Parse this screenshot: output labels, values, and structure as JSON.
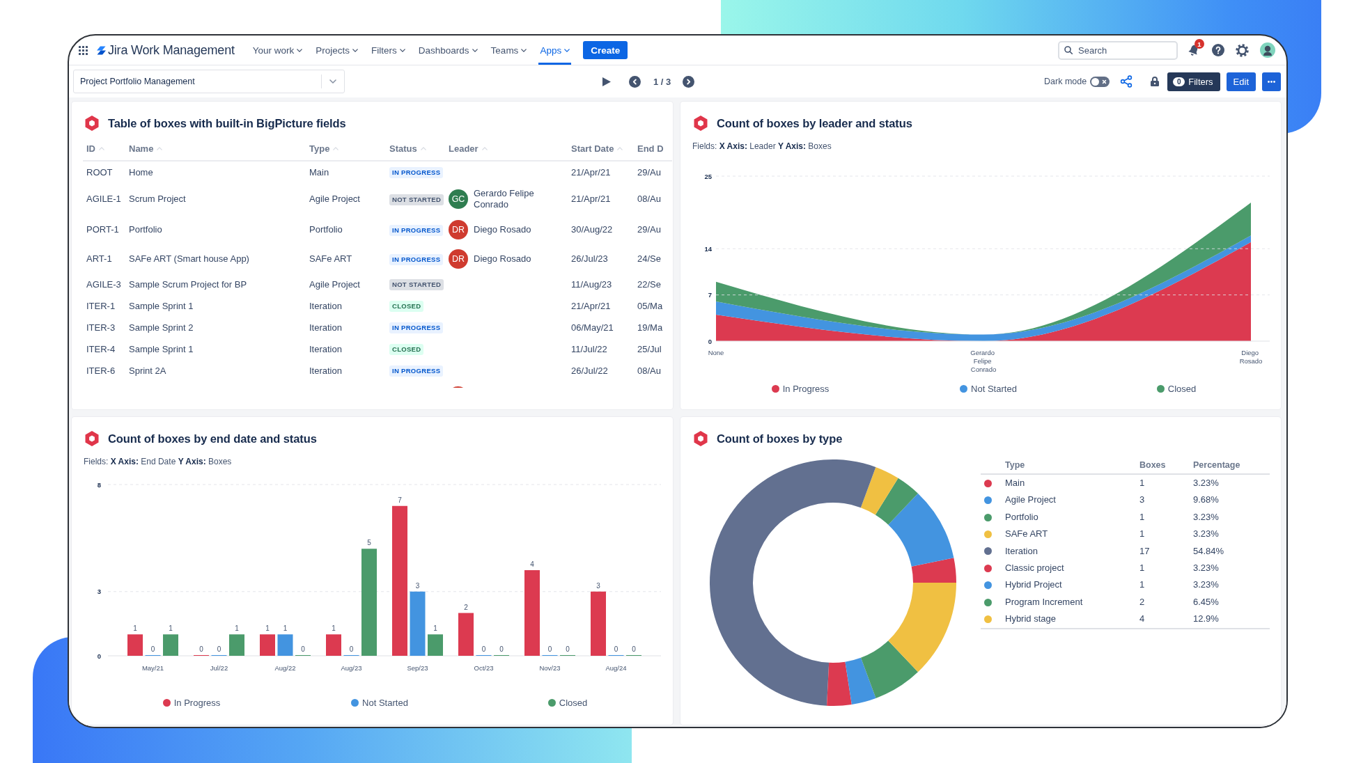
{
  "header": {
    "app_name": "Jira Work Management",
    "nav_items": [
      {
        "label": "Your work",
        "selected": false
      },
      {
        "label": "Projects",
        "selected": false
      },
      {
        "label": "Filters",
        "selected": false
      },
      {
        "label": "Dashboards",
        "selected": false
      },
      {
        "label": "Teams",
        "selected": false
      },
      {
        "label": "Apps",
        "selected": true
      }
    ],
    "create_button": "Create",
    "search": {
      "placeholder": "Search"
    },
    "notification_count": "1"
  },
  "toolbar": {
    "board_select": {
      "value": "Project Portfolio Management"
    },
    "pager": "1 / 3",
    "dark_mode": {
      "label": "Dark mode",
      "on": false
    },
    "filters_button": {
      "count": "0",
      "label": "Filters"
    },
    "edit_button": "Edit"
  },
  "panels": [
    {
      "kind": "table",
      "title": "Table of boxes with built-in BigPicture fields",
      "columns": [
        "ID",
        "Name",
        "Type",
        "Status",
        "Leader",
        "Start Date",
        "End D"
      ],
      "rows": [
        {
          "id": "ROOT",
          "name": "Home",
          "type": "Main",
          "status": {
            "label": "IN PROGRESS",
            "kind": "in_progress"
          },
          "start_date": "21/Apr/21",
          "column_7": "29/Au"
        },
        {
          "id": "AGILE-1",
          "name": "Scrum Project",
          "type": "Agile Project",
          "status": {
            "label": "NOT STARTED",
            "kind": "not_started"
          },
          "leader": {
            "initials": "GC",
            "name": "Gerardo Felipe Conrado",
            "color": "#2f7d50"
          },
          "start_date": "21/Apr/21",
          "column_7": "08/Au"
        },
        {
          "id": "PORT-1",
          "name": "Portfolio",
          "type": "Portfolio",
          "status": {
            "label": "IN PROGRESS",
            "kind": "in_progress"
          },
          "leader": {
            "initials": "DR",
            "name": "Diego Rosado",
            "color": "#cf3b2f"
          },
          "start_date": "30/Aug/22",
          "column_7": "29/Au"
        },
        {
          "id": "ART-1",
          "name": "SAFe ART (Smart house App)",
          "type": "SAFe ART",
          "status": {
            "label": "IN PROGRESS",
            "kind": "in_progress"
          },
          "leader": {
            "initials": "DR",
            "name": "Diego Rosado",
            "color": "#cf3b2f"
          },
          "start_date": "26/Jul/23",
          "column_7": "24/Se"
        },
        {
          "id": "AGILE-3",
          "name": "Sample Scrum Project for BP",
          "type": "Agile Project",
          "status": {
            "label": "NOT STARTED",
            "kind": "not_started"
          },
          "start_date": "11/Aug/23",
          "column_7": "22/Se"
        },
        {
          "id": "ITER-1",
          "name": "Sample Sprint 1",
          "type": "Iteration",
          "status": {
            "label": "CLOSED",
            "kind": "closed"
          },
          "start_date": "21/Apr/21",
          "column_7": "05/Ma"
        },
        {
          "id": "ITER-3",
          "name": "Sample Sprint 2",
          "type": "Iteration",
          "status": {
            "label": "IN PROGRESS",
            "kind": "in_progress"
          },
          "start_date": "06/May/21",
          "column_7": "19/Ma"
        },
        {
          "id": "ITER-4",
          "name": "Sample Sprint 1",
          "type": "Iteration",
          "status": {
            "label": "CLOSED",
            "kind": "closed"
          },
          "start_date": "11/Jul/22",
          "column_7": "25/Jul"
        },
        {
          "id": "ITER-6",
          "name": "Sprint 2A",
          "type": "Iteration",
          "status": {
            "label": "IN PROGRESS",
            "kind": "in_progress"
          },
          "start_date": "26/Jul/22",
          "column_7": "08/Au"
        },
        {
          "leader": {
            "color": "#cf3b2f"
          }
        }
      ]
    },
    {
      "kind": "chart",
      "title": "Count of boxes by leader and status",
      "fields": "Fields: **X Axis:** Leader **Y Axis:** Boxes",
      "chart_data": {
        "type": "area",
        "stacked": true,
        "categories": [
          "None",
          "Gerardo Felipe Conrado",
          "Diego Rosado"
        ],
        "series": [
          {
            "name": "In Progress",
            "color": "#dc3a50",
            "values": [
              4,
              0,
              15
            ]
          },
          {
            "name": "Not Started",
            "color": "#4394e0",
            "values": [
              2,
              1,
              1
            ]
          },
          {
            "name": "Closed",
            "color": "#4b9b6b",
            "values": [
              3,
              0,
              5
            ]
          }
        ],
        "ylim": [
          0,
          25
        ],
        "yticks": [
          0,
          7,
          14,
          25
        ],
        "legend": "bottom"
      }
    },
    {
      "kind": "chart",
      "title": "Count of boxes by end date and status",
      "fields": "Fields: **X Axis:** End Date **Y Axis:** Boxes",
      "chart_data": {
        "type": "bar",
        "categories": [
          "May/21",
          "Jul/22",
          "Aug/22",
          "Aug/23",
          "Sep/23",
          "Oct/23",
          "Nov/23",
          "Aug/24"
        ],
        "series": [
          {
            "name": "In Progress",
            "color": "#dc3a50",
            "values": [
              1,
              0,
              1,
              1,
              7,
              2,
              4,
              3
            ]
          },
          {
            "name": "Not Started",
            "color": "#4394e0",
            "values": [
              0,
              0,
              1,
              0,
              3,
              0,
              0,
              0
            ]
          },
          {
            "name": "Closed",
            "color": "#4b9b6b",
            "values": [
              1,
              1,
              0,
              5,
              1,
              0,
              0,
              0
            ]
          }
        ],
        "ylim": [
          0,
          8
        ],
        "yticks": [
          0,
          3,
          8
        ],
        "data_labels": true,
        "legend": "bottom"
      }
    },
    {
      "kind": "breakdown",
      "title": "Count of boxes by type",
      "chart_data": {
        "type": "donut",
        "values": [
          3.23,
          9.68,
          3.23,
          3.23,
          54.84,
          3.23,
          3.23,
          6.45,
          12.9
        ]
      },
      "table": {
        "columns": [
          "Type",
          "Boxes",
          "Percentage"
        ],
        "rows": [
          {
            "type": "Main",
            "boxes": "1",
            "percentage": "3.23%",
            "color": "#dc3a50"
          },
          {
            "type": "Agile Project",
            "boxes": "3",
            "percentage": "9.68%",
            "color": "#4394e0"
          },
          {
            "type": "Portfolio",
            "boxes": "1",
            "percentage": "3.23%",
            "color": "#4b9b6b"
          },
          {
            "type": "SAFe ART",
            "boxes": "1",
            "percentage": "3.23%",
            "color": "#f0c042"
          },
          {
            "type": "Iteration",
            "boxes": "17",
            "percentage": "54.84%",
            "color": "#627090"
          },
          {
            "type": "Classic project",
            "boxes": "1",
            "percentage": "3.23%",
            "color": "#dc3a50"
          },
          {
            "type": "Hybrid Project",
            "boxes": "1",
            "percentage": "3.23%",
            "color": "#4394e0"
          },
          {
            "type": "Program Increment",
            "boxes": "2",
            "percentage": "6.45%",
            "color": "#4b9b6b"
          },
          {
            "type": "Hybrid stage",
            "boxes": "4",
            "percentage": "12.9%",
            "color": "#f0c042"
          }
        ]
      }
    }
  ]
}
